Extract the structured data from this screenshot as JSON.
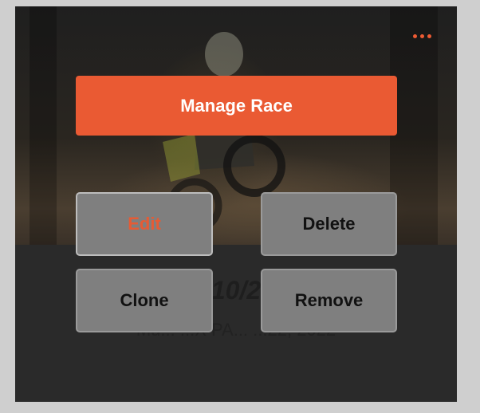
{
  "card": {
    "race_date": "10/2",
    "race_title": "Mu... ...X PA... ...22, 2022",
    "menu_icon": "more-horizontal-icon",
    "accent_color": "#ea5a33"
  },
  "manage": {
    "label": "Manage Race"
  },
  "actions": {
    "edit": "Edit",
    "delete": "Delete",
    "clone": "Clone",
    "remove": "Remove"
  }
}
